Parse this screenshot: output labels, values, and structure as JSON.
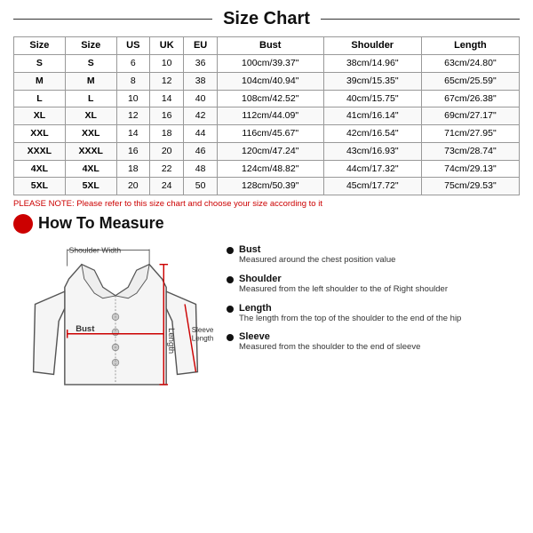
{
  "title": "Size Chart",
  "table": {
    "headers": [
      "Size",
      "Size",
      "US",
      "UK",
      "EU",
      "Bust",
      "Shoulder",
      "Length"
    ],
    "rows": [
      [
        "S",
        "S",
        "6",
        "10",
        "36",
        "100cm/39.37\"",
        "38cm/14.96\"",
        "63cm/24.80\""
      ],
      [
        "M",
        "M",
        "8",
        "12",
        "38",
        "104cm/40.94\"",
        "39cm/15.35\"",
        "65cm/25.59\""
      ],
      [
        "L",
        "L",
        "10",
        "14",
        "40",
        "108cm/42.52\"",
        "40cm/15.75\"",
        "67cm/26.38\""
      ],
      [
        "XL",
        "XL",
        "12",
        "16",
        "42",
        "112cm/44.09\"",
        "41cm/16.14\"",
        "69cm/27.17\""
      ],
      [
        "XXL",
        "XXL",
        "14",
        "18",
        "44",
        "116cm/45.67\"",
        "42cm/16.54\"",
        "71cm/27.95\""
      ],
      [
        "XXXL",
        "XXXL",
        "16",
        "20",
        "46",
        "120cm/47.24\"",
        "43cm/16.93\"",
        "73cm/28.74\""
      ],
      [
        "4XL",
        "4XL",
        "18",
        "22",
        "48",
        "124cm/48.82\"",
        "44cm/17.32\"",
        "74cm/29.13\""
      ],
      [
        "5XL",
        "5XL",
        "20",
        "24",
        "50",
        "128cm/50.39\"",
        "45cm/17.72\"",
        "75cm/29.53\""
      ]
    ]
  },
  "please_note": "PLEASE NOTE: Please refer to this size chart and choose your size according to it",
  "how_to_measure": {
    "title": "How To Measure",
    "items": [
      {
        "label": "Bust",
        "desc": "Measured around the chest position value"
      },
      {
        "label": "Shoulder",
        "desc": "Measured from the left shoulder to the of Right shoulder"
      },
      {
        "label": "Length",
        "desc": "The length from the top of the shoulder to the end of the hip"
      },
      {
        "label": "Sleeve",
        "desc": "Measured from the shoulder to the end of sleeve"
      }
    ]
  },
  "jacket_labels": {
    "shoulder_width": "Shoulder Width",
    "bust": "Bust",
    "sleeve_length": "Sleeve\nLength",
    "length": "Length"
  }
}
